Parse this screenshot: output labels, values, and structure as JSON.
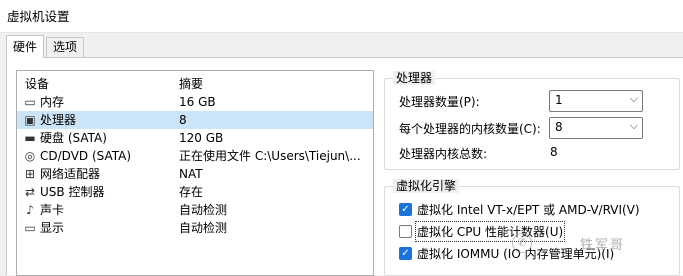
{
  "window": {
    "title": "虚拟机设置"
  },
  "tabs": [
    {
      "label": "硬件",
      "active": true
    },
    {
      "label": "选项",
      "active": false
    }
  ],
  "device_list": {
    "headers": {
      "device": "设备",
      "summary": "摘要"
    },
    "rows": [
      {
        "icon": "memory-icon",
        "name": "内存",
        "summary": "16 GB"
      },
      {
        "icon": "processor-icon",
        "name": "处理器",
        "summary": "8",
        "selected": true
      },
      {
        "icon": "hard-disk-icon",
        "name": "硬盘 (SATA)",
        "summary": "120 GB"
      },
      {
        "icon": "cd-dvd-icon",
        "name": "CD/DVD (SATA)",
        "summary": "正在使用文件 C:\\Users\\Tiejun\\..."
      },
      {
        "icon": "network-adapter-icon",
        "name": "网络适配器",
        "summary": "NAT"
      },
      {
        "icon": "usb-controller-icon",
        "name": "USB 控制器",
        "summary": "存在"
      },
      {
        "icon": "sound-card-icon",
        "name": "声卡",
        "summary": "自动检测"
      },
      {
        "icon": "display-icon",
        "name": "显示",
        "summary": "自动检测"
      }
    ]
  },
  "processor_group": {
    "label": "处理器",
    "num_processors_label": "处理器数量(P):",
    "num_processors_value": "1",
    "cores_per_processor_label": "每个处理器的内核数量(C):",
    "cores_per_processor_value": "8",
    "total_cores_label": "处理器内核总数:",
    "total_cores_value": "8"
  },
  "virtualization_group": {
    "label": "虚拟化引擎",
    "options": [
      {
        "label": "虚拟化 Intel VT-x/EPT 或 AMD-V/RVI(V)",
        "checked": true
      },
      {
        "label": "虚拟化 CPU 性能计数器(U)",
        "checked": false
      },
      {
        "label": "虚拟化 IOMMU (IO 内存管理单元)(I)",
        "checked": true
      }
    ]
  },
  "watermark": {
    "text": "铁军哥"
  },
  "colors": {
    "accent": "#1a73d9",
    "selection": "#cce4f7"
  }
}
